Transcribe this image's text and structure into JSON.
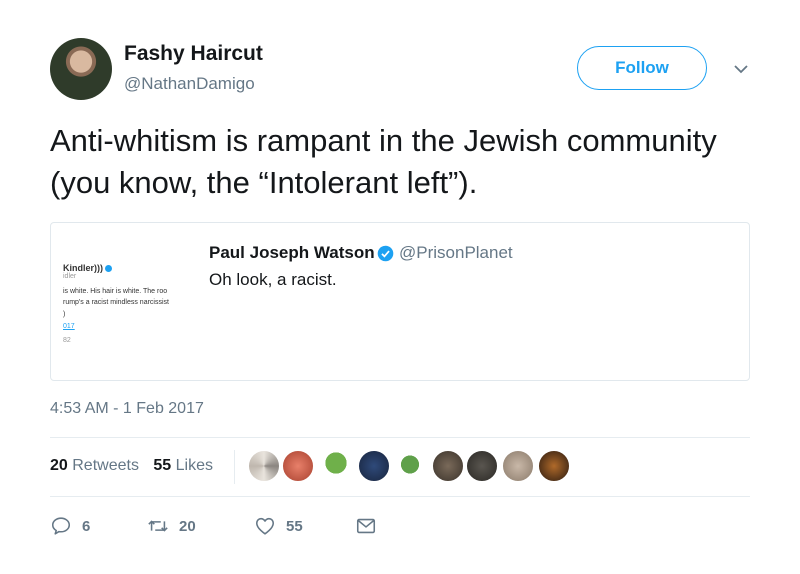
{
  "author": {
    "name": "Fashy Haircut",
    "handle": "@NathanDamigo",
    "avatar_icon": "avatar-photo"
  },
  "follow_button": {
    "label": "Follow",
    "color": "#1da1f2"
  },
  "tweet": {
    "text": "Anti-whitism is rampant in the Jewish community (you know, the “Intolerant left”).",
    "timestamp": "4:53 AM - 1 Feb 2017"
  },
  "quoted_tweet": {
    "name": "Paul Joseph Watson",
    "handle": "@PrisonPlanet",
    "text": "Oh look, a racist.",
    "verified_icon": "verified-badge-icon",
    "thumbnail": {
      "line1": "Kindler)))",
      "line2": "idler",
      "line3": "is white. His hair is white. The roo",
      "line4": "rump's a racist mindless narcissist",
      "line5": ")",
      "line6": "017",
      "line7": "82"
    }
  },
  "stats": {
    "retweets_count": "20",
    "retweets_label": "Retweets",
    "likes_count": "55",
    "likes_label": "Likes"
  },
  "actions": {
    "reply_count": "6",
    "retweet_count": "20",
    "like_count": "55",
    "reply_icon": "reply-icon",
    "retweet_icon": "retweet-icon",
    "like_icon": "heart-icon",
    "dm_icon": "envelope-icon"
  },
  "colors": {
    "accent": "#1da1f2",
    "secondary_text": "#657786",
    "primary_text": "#14171a"
  }
}
